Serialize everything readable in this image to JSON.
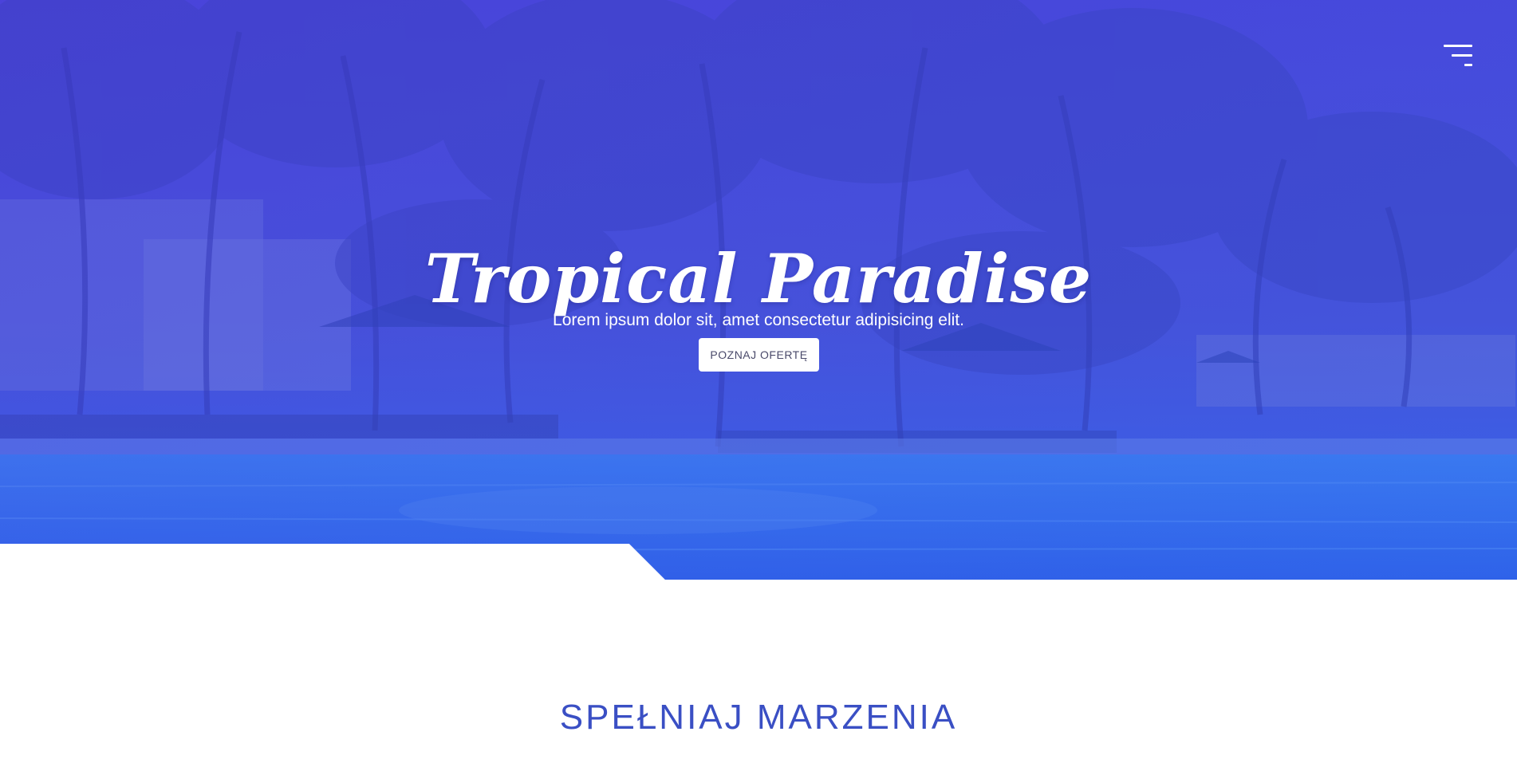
{
  "hero": {
    "title": "Tropical Paradise",
    "subtitle": "Lorem ipsum dolor sit, amet consectetur adipisicing elit.",
    "cta_label": "POZNAJ OFERTĘ",
    "overlay_top_color": "#3f3fd8",
    "overlay_bottom_color": "#2b6bf0"
  },
  "nav": {
    "menu_icon": "menu-icon"
  },
  "section": {
    "heading": "SPEŁNIAJ MARZENIA",
    "heading_color": "#3a4fc4"
  }
}
